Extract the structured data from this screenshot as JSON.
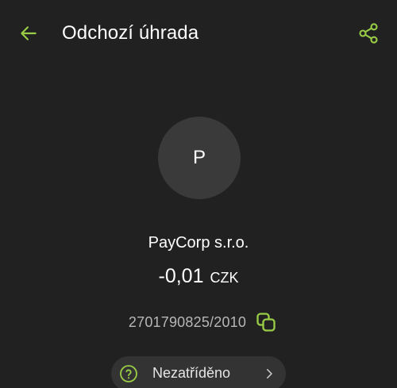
{
  "header": {
    "title": "Odchozí úhrada",
    "back_icon": "arrow-left-icon",
    "share_icon": "share-icon"
  },
  "payee": {
    "initial": "P",
    "name": "PayCorp s.r.o."
  },
  "amount": {
    "value": "-0,01",
    "currency": "CZK"
  },
  "account": {
    "number": "2701790825/2010",
    "copy_icon": "copy-icon"
  },
  "category": {
    "label": "Nezatříděno",
    "help_icon": "help-circle-icon",
    "chevron_icon": "chevron-right-icon"
  },
  "colors": {
    "background": "#212121",
    "accent": "#9acd46",
    "avatar_bg": "#3a3a3a",
    "chip_bg": "#333333",
    "muted_text": "#b7b7b7"
  }
}
